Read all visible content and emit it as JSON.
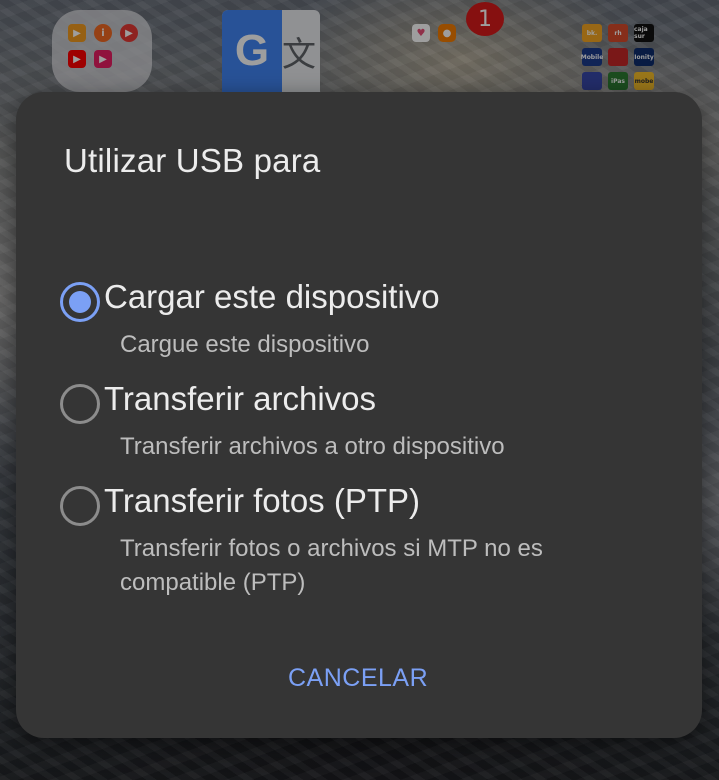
{
  "dialog": {
    "title": "Utilizar USB para",
    "options": [
      {
        "label": "Cargar este dispositivo",
        "description": "Cargue este dispositivo",
        "selected": true
      },
      {
        "label": "Transferir archivos",
        "description": "Transferir archivos a otro dispositivo",
        "selected": false
      },
      {
        "label": "Transferir fotos (PTP)",
        "description": "Transferir fotos o archivos si MTP no es compatible (PTP)",
        "selected": false
      }
    ],
    "cancel_label": "CANCELAR"
  },
  "home": {
    "notification_badge": "1",
    "translate_icon_glyphs": {
      "left": "G",
      "right": "文"
    },
    "app_grid_labels": [
      "bk.",
      "rh",
      "caja sur",
      "Mobile",
      "",
      "Ionity",
      "",
      "",
      "iPas",
      "mobe"
    ]
  },
  "colors": {
    "accent": "#7ba0f5",
    "dialog_bg": "#353535",
    "badge": "#d81a1a"
  }
}
